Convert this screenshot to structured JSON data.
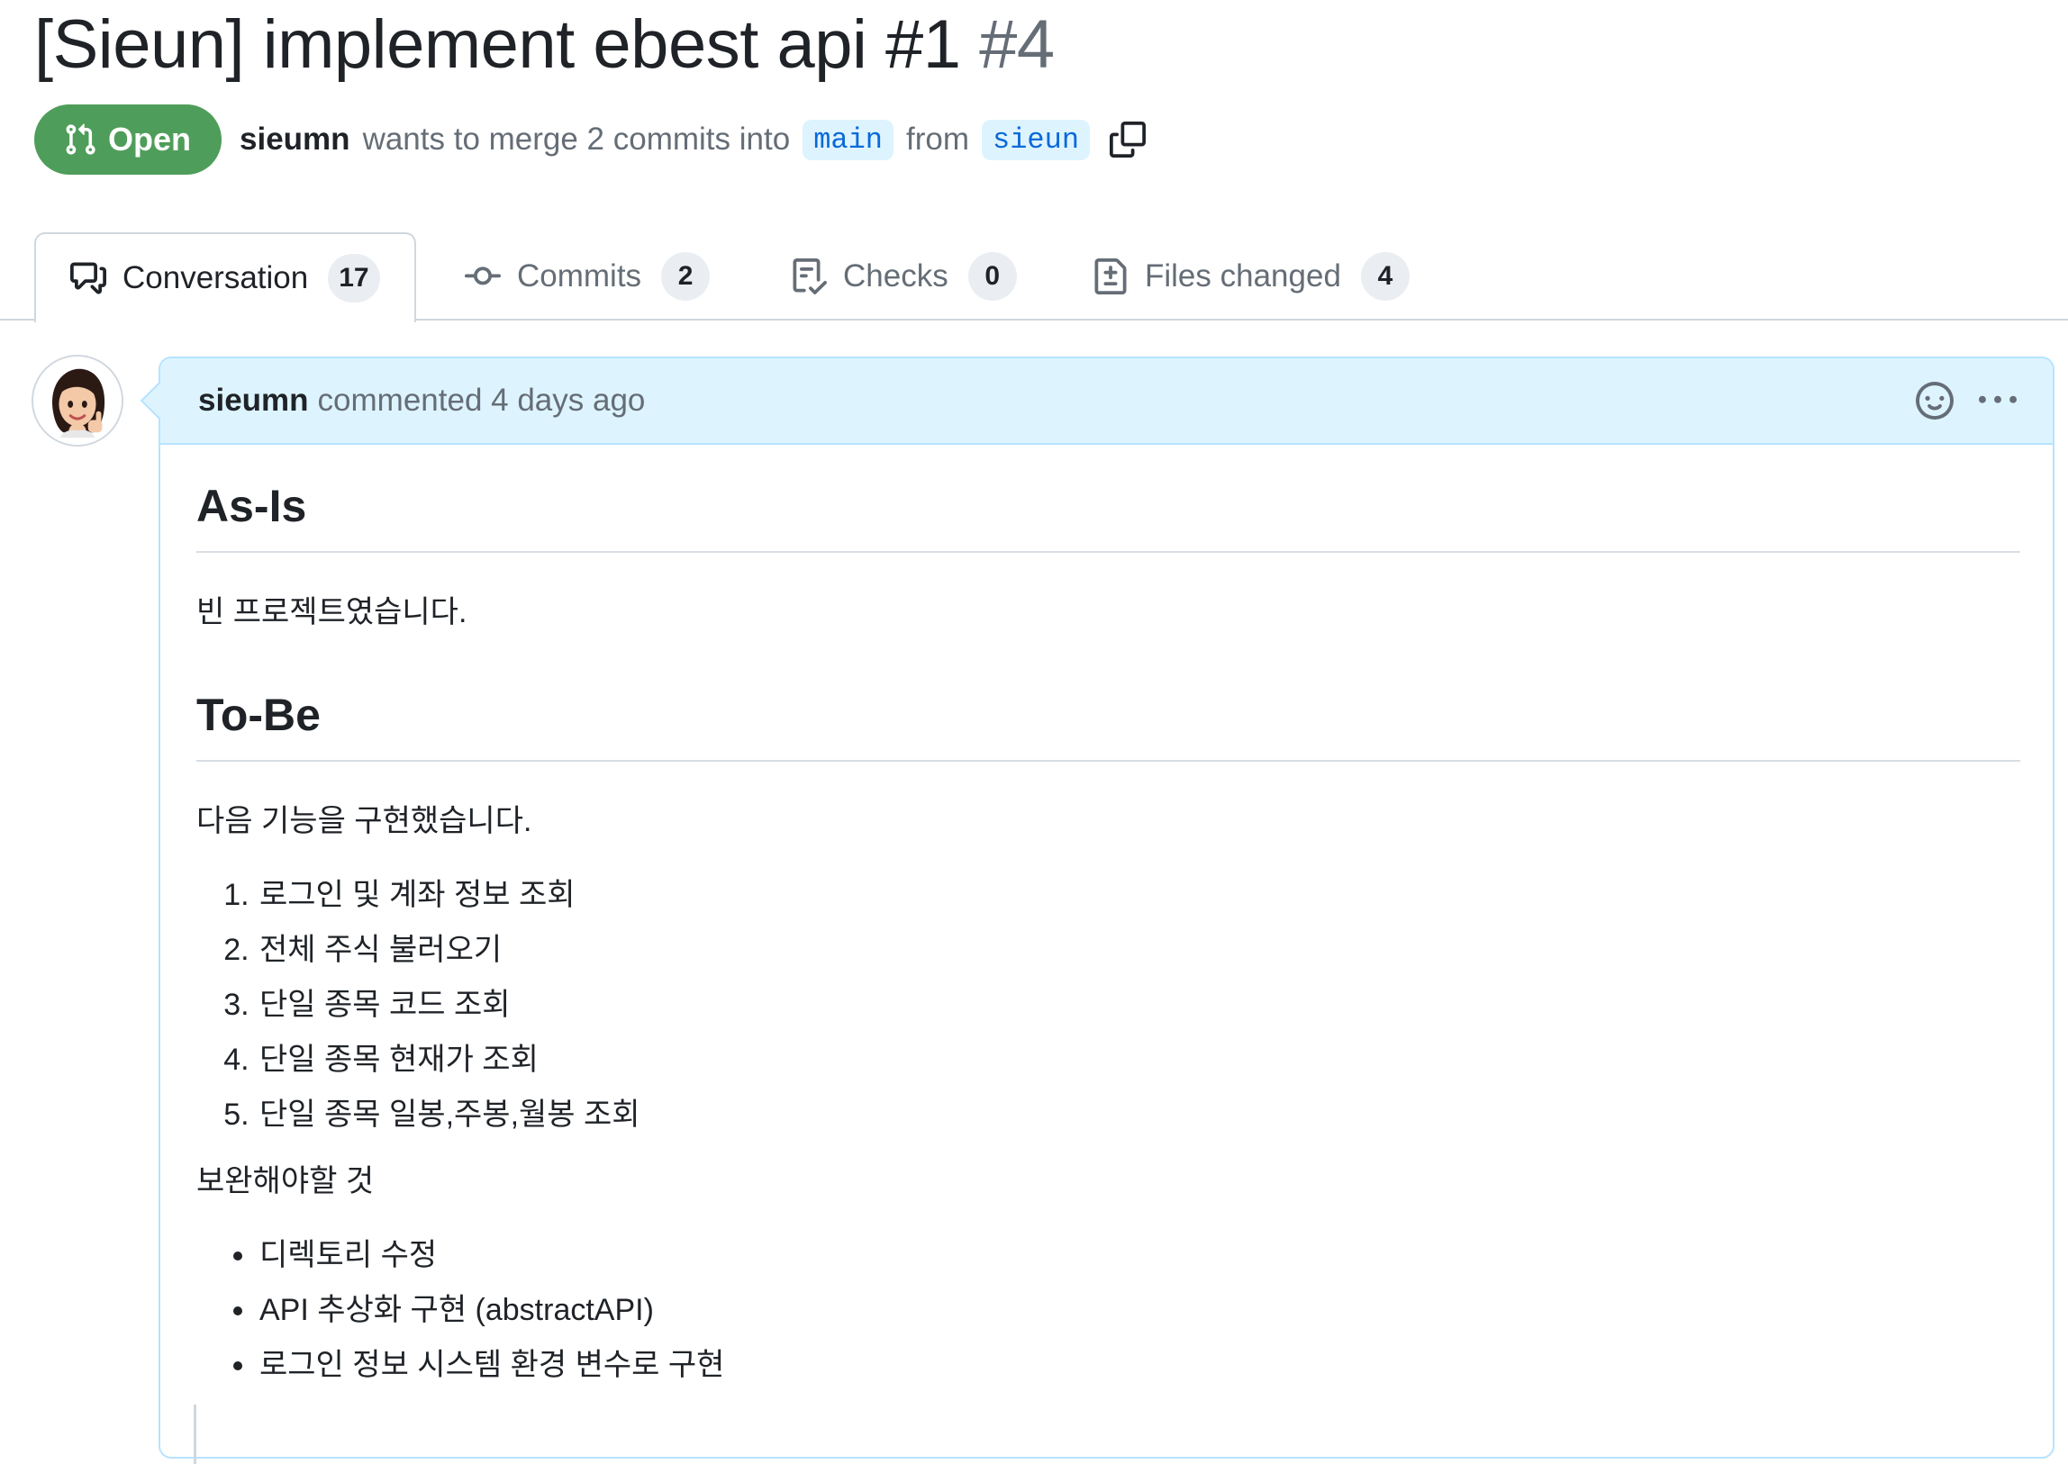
{
  "pr": {
    "title": "[Sieun] implement ebest api #1",
    "number": "#4",
    "state": "Open",
    "author": "sieumn",
    "merge_text": "wants to merge 2 commits into",
    "base_branch": "main",
    "from_text": "from",
    "head_branch": "sieun"
  },
  "tabs": [
    {
      "label": "Conversation",
      "count": "17",
      "icon": "comment-discussion-icon",
      "selected": true
    },
    {
      "label": "Commits",
      "count": "2",
      "icon": "git-commit-icon",
      "selected": false
    },
    {
      "label": "Checks",
      "count": "0",
      "icon": "checklist-icon",
      "selected": false
    },
    {
      "label": "Files changed",
      "count": "4",
      "icon": "file-diff-icon",
      "selected": false
    }
  ],
  "comment": {
    "author": "sieumn",
    "meta": "commented 4 days ago",
    "body": {
      "h_asis": "As-Is",
      "p_asis": "빈 프로젝트였습니다.",
      "h_tobe": "To-Be",
      "p_tobe": "다음 기능을 구현했습니다.",
      "features": [
        "로그인 및 계좌 정보 조회",
        "전체 주식 불러오기",
        "단일 종목 코드 조회",
        "단일 종목 현재가 조회",
        "단일 종목 일봉,주봉,월봉 조회"
      ],
      "p_todo": "보완해야할 것",
      "todos": [
        "디렉토리 수정",
        "API 추상화 구현 (abstractAPI)",
        "로그인 정보 시스템 환경 변수로 구현"
      ]
    }
  },
  "colors": {
    "open_green": "#4f9d5a",
    "header_blue": "#ddf4ff",
    "link_blue": "#0969da",
    "muted": "#656d76",
    "text": "#1f2328"
  }
}
